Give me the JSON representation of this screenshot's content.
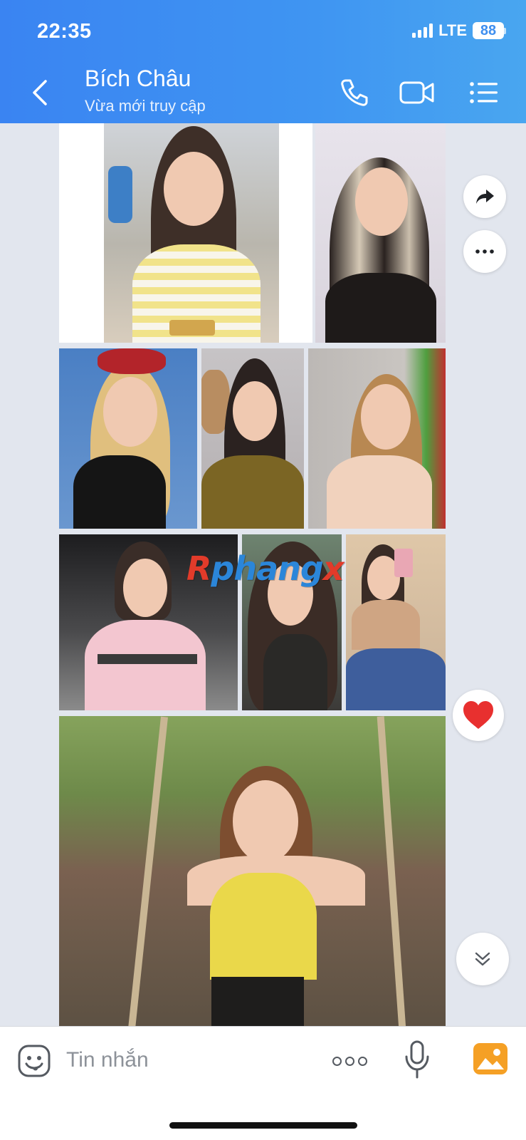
{
  "status_bar": {
    "time": "22:35",
    "network": "LTE",
    "battery": "88"
  },
  "header": {
    "contact_name": "Bích Châu",
    "contact_status": "Vừa mới truy cập"
  },
  "watermark": {
    "part1": "R",
    "part2": "phang",
    "part3": "x"
  },
  "input": {
    "placeholder": "Tin nhắn"
  },
  "colors": {
    "header_start": "#3a84f2",
    "header_end": "#49a6f0",
    "chat_bg": "#e2e6ee",
    "heart": "#e8302f"
  },
  "icons": [
    "back-icon",
    "phone-icon",
    "video-call-icon",
    "menu-icon",
    "forward-icon",
    "more-icon",
    "heart-icon",
    "scroll-down-icon",
    "emoji-icon",
    "more-options-icon",
    "microphone-icon",
    "gallery-icon"
  ]
}
